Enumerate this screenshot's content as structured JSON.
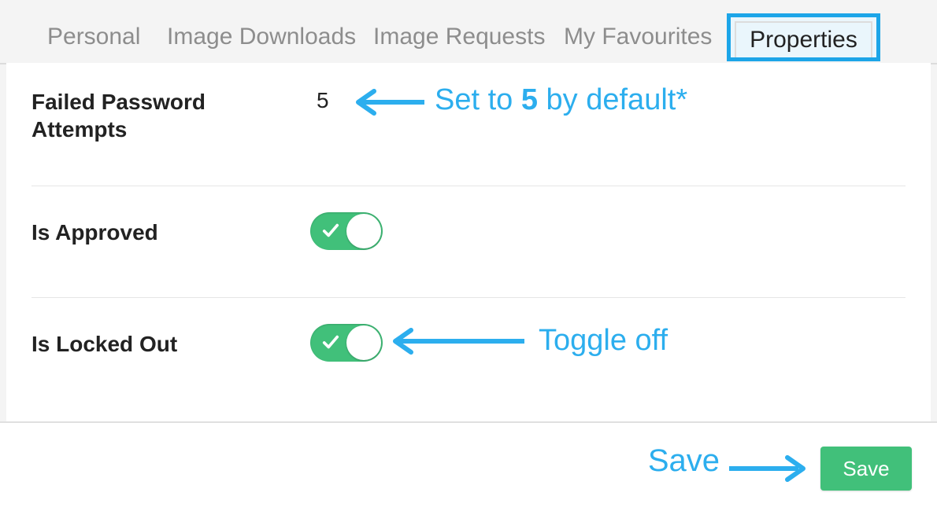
{
  "tabs": {
    "personal": "Personal",
    "image_downloads": "Image Downloads",
    "image_requests": "Image Requests",
    "my_favourites": "My Favourites",
    "properties": "Properties"
  },
  "rows": {
    "failed_password_label": "Failed Password Attempts",
    "failed_password_value": "5",
    "is_approved_label": "Is Approved",
    "is_locked_out_label": "Is Locked Out"
  },
  "buttons": {
    "save": "Save"
  },
  "annotations": {
    "default5_pre": "Set to ",
    "default5_bold": "5",
    "default5_post": " by default*",
    "toggle_off": "Toggle off",
    "save": "Save"
  }
}
